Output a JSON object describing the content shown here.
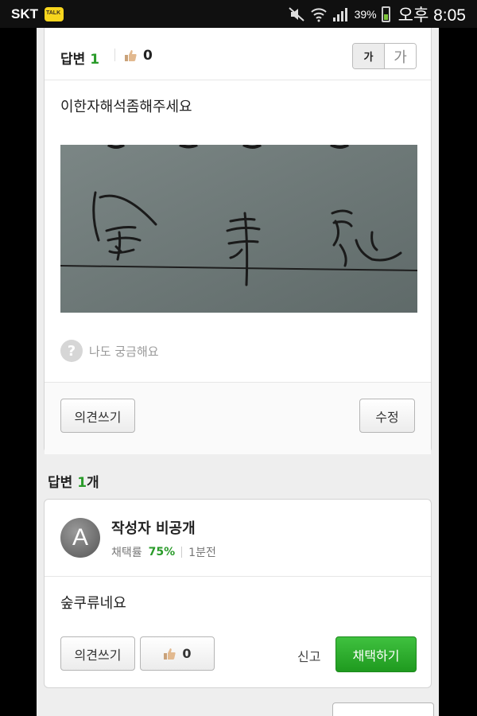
{
  "status_bar": {
    "carrier": "SKT",
    "battery_percent": "39%",
    "time": "오후 8:05"
  },
  "question": {
    "answer_label": "답변",
    "answer_count": "1",
    "like_count": "0",
    "font_small": "가",
    "font_large": "가",
    "body": "이한자해석좀해주세요",
    "curious_label": "나도 궁금해요",
    "opinion_button": "의견쓰기",
    "edit_button": "수정"
  },
  "answers_heading": {
    "label": "답변",
    "count": "1",
    "unit": "개"
  },
  "answer": {
    "avatar_letter": "A",
    "author": "작성자 비공개",
    "adoption_label": "채택률",
    "adoption_rate": "75%",
    "time_ago": "1분전",
    "text": "숲쿠류네요",
    "opinion_button": "의견쓰기",
    "like_count": "0",
    "report": "신고",
    "select_button": "채택하기"
  },
  "colors": {
    "accent_green": "#2a9b2a",
    "select_button": "#2fae2f"
  }
}
